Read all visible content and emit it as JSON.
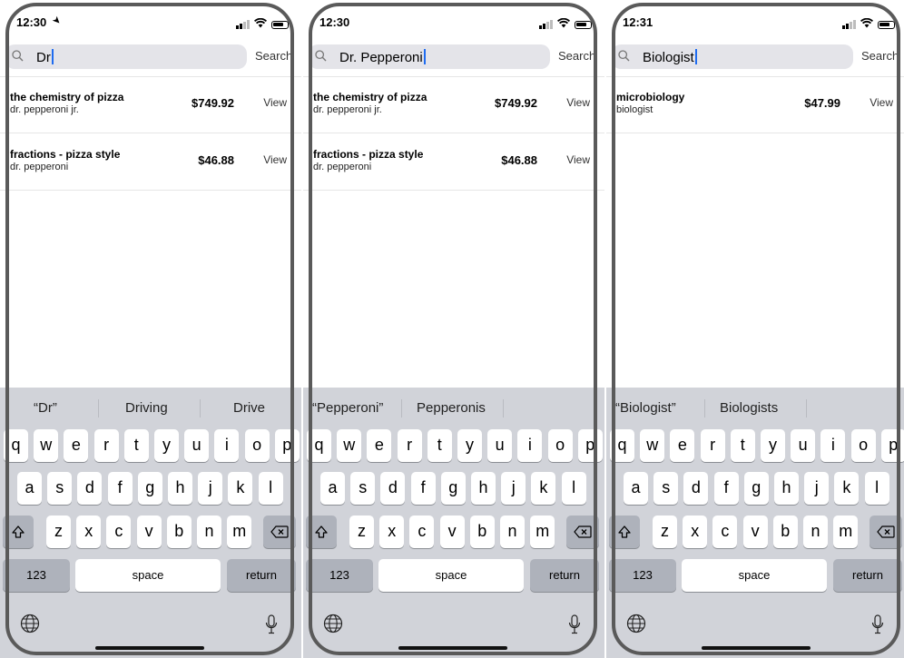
{
  "colors": {
    "accent": "#1f6cf0",
    "keyboard_bg": "#d1d3d9",
    "search_bg": "#e4e4e9"
  },
  "keyboard": {
    "row1": [
      "q",
      "w",
      "e",
      "r",
      "t",
      "y",
      "u",
      "i",
      "o",
      "p"
    ],
    "row2": [
      "a",
      "s",
      "d",
      "f",
      "g",
      "h",
      "j",
      "k",
      "l"
    ],
    "row3": [
      "z",
      "x",
      "c",
      "v",
      "b",
      "n",
      "m"
    ],
    "numbers_label": "123",
    "space_label": "space",
    "return_label": "return",
    "icons": {
      "shift": "shift-icon",
      "delete": "delete-icon",
      "globe": "globe-icon",
      "mic": "microphone-icon"
    }
  },
  "screens": [
    {
      "time": "12:30",
      "location_arrow": true,
      "search_query": "Dr",
      "search_button": "Search",
      "results": [
        {
          "title": "the chemistry of pizza",
          "author": "dr. pepperoni jr.",
          "price": "$749.92",
          "action": "View"
        },
        {
          "title": "fractions - pizza style",
          "author": "dr. pepperoni",
          "price": "$46.88",
          "action": "View"
        }
      ],
      "suggestions": [
        "“Dr”",
        "Driving",
        "Drive"
      ]
    },
    {
      "time": "12:30",
      "location_arrow": false,
      "search_query": "Dr. Pepperoni",
      "search_button": "Search",
      "results": [
        {
          "title": "the chemistry of pizza",
          "author": "dr. pepperoni jr.",
          "price": "$749.92",
          "action": "View"
        },
        {
          "title": "fractions - pizza style",
          "author": "dr. pepperoni",
          "price": "$46.88",
          "action": "View"
        }
      ],
      "suggestions": [
        "“Pepperoni”",
        "Pepperonis",
        ""
      ]
    },
    {
      "time": "12:31",
      "location_arrow": false,
      "search_query": "Biologist",
      "search_button": "Search",
      "results": [
        {
          "title": "microbiology",
          "author": "biologist",
          "price": "$47.99",
          "action": "View"
        }
      ],
      "suggestions": [
        "“Biologist”",
        "Biologists",
        ""
      ]
    }
  ]
}
